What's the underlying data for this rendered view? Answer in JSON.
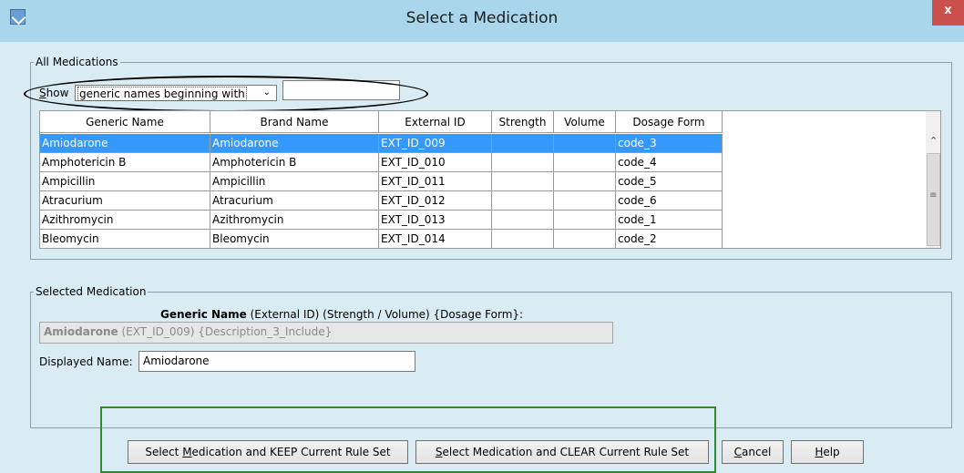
{
  "window": {
    "title": "Select a Medication",
    "close_label": "x"
  },
  "all_medications": {
    "legend": "All Medications",
    "show_label": "Show",
    "filter_option": "generic names beginning with",
    "filter_text": "",
    "columns": [
      "Generic Name",
      "Brand Name",
      "External ID",
      "Strength",
      "Volume",
      "Dosage Form"
    ],
    "rows": [
      {
        "generic": "Amiodarone",
        "brand": "Amiodarone",
        "ext_id": "EXT_ID_009",
        "strength": "",
        "volume": "",
        "form": "code_3",
        "selected": true
      },
      {
        "generic": "Amphotericin B",
        "brand": "Amphotericin B",
        "ext_id": "EXT_ID_010",
        "strength": "",
        "volume": "",
        "form": "code_4",
        "selected": false
      },
      {
        "generic": "Ampicillin",
        "brand": "Ampicillin",
        "ext_id": "EXT_ID_011",
        "strength": "",
        "volume": "",
        "form": "code_5",
        "selected": false
      },
      {
        "generic": "Atracurium",
        "brand": "Atracurium",
        "ext_id": "EXT_ID_012",
        "strength": "",
        "volume": "",
        "form": "code_6",
        "selected": false
      },
      {
        "generic": "Azithromycin",
        "brand": "Azithromycin",
        "ext_id": "EXT_ID_013",
        "strength": "",
        "volume": "",
        "form": "code_1",
        "selected": false
      },
      {
        "generic": "Bleomycin",
        "brand": "Bleomycin",
        "ext_id": "EXT_ID_014",
        "strength": "",
        "volume": "",
        "form": "code_2",
        "selected": false
      }
    ]
  },
  "selected_medication": {
    "legend": "Selected Medication",
    "format_bold": "Generic Name",
    "format_rest": " (External ID)  (Strength / Volume)  {Dosage Form}:",
    "preview_bold": "Amiodarone",
    "preview_rest": " (EXT_ID_009) {Description_3_Include}",
    "displayed_name_label": "Displayed Name:",
    "displayed_name_value": "Amiodarone"
  },
  "buttons": {
    "keep": {
      "pre": "Select ",
      "key": "M",
      "post": "edication and KEEP Current Rule Set"
    },
    "clear": {
      "pre": "",
      "key": "S",
      "post": "elect Medication and CLEAR Current Rule Set"
    },
    "cancel": {
      "pre": "",
      "key": "C",
      "post": "ancel"
    },
    "help": {
      "pre": "",
      "key": "H",
      "post": "elp"
    }
  },
  "colors": {
    "titlebar": "#a9d6ea",
    "background": "#d9ebf3",
    "selection": "#3399ff",
    "highlight_green": "#2f8a2f",
    "close": "#c9504b"
  }
}
